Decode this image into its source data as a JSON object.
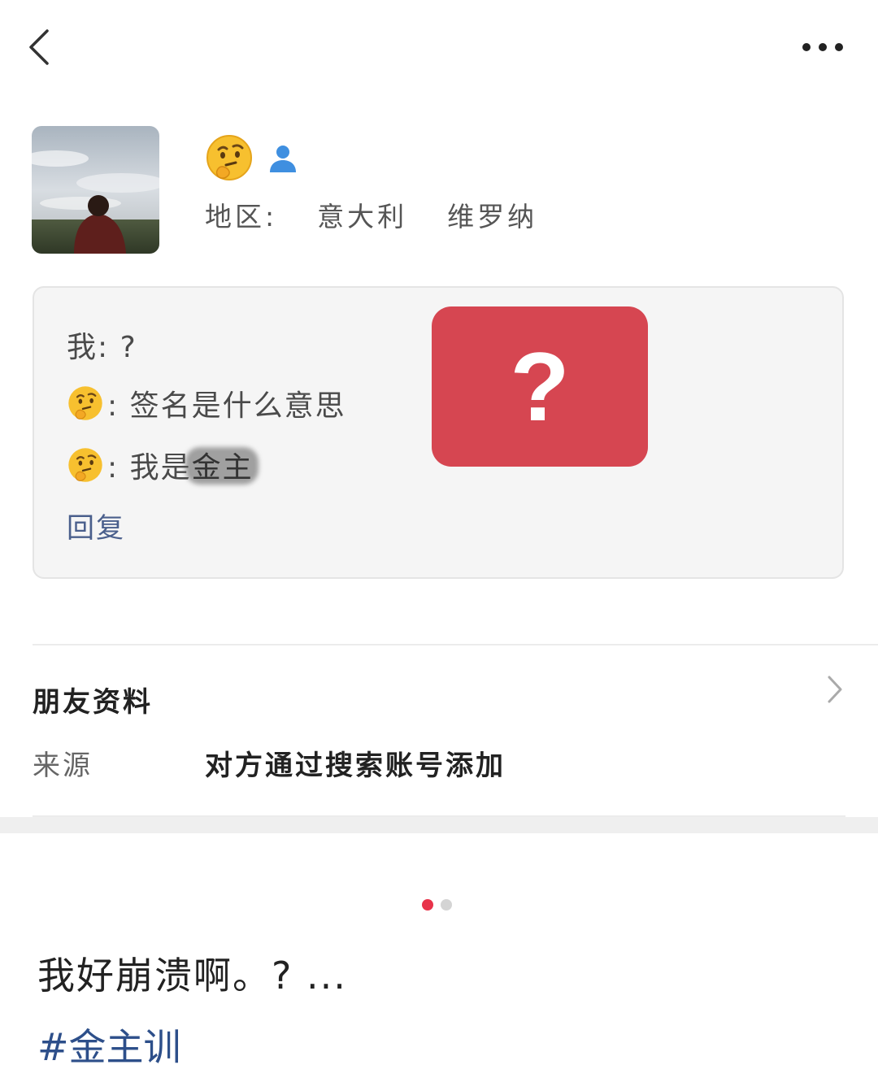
{
  "header": {
    "back_icon": "chevron-left-icon",
    "more_icon": "more-horizontal-icon"
  },
  "profile": {
    "avatar_description_icon": "avatar",
    "name_emoji": "thinking-face-emoji",
    "verified_icon": "person-icon",
    "region_label": "地区:",
    "region_country": "意大利",
    "region_city": "维罗纳"
  },
  "signature": {
    "line1": "我: ?",
    "line2_text": ": 签名是什么意思",
    "line3_prefix": ": 我是",
    "line3_hidden": "金主",
    "reply_label": "回复",
    "sticker_text": "?",
    "sticker_color": "#d64651"
  },
  "friend_info": {
    "section_title": "朋友资料",
    "source_label": "来源",
    "source_value": "对方通过搜索账号添加"
  },
  "pager": {
    "active_color": "#e8334a",
    "inactive_color": "#d4d4d4"
  },
  "post": {
    "caption": "我好崩溃啊。? ...",
    "hashtag": "#金主训"
  }
}
